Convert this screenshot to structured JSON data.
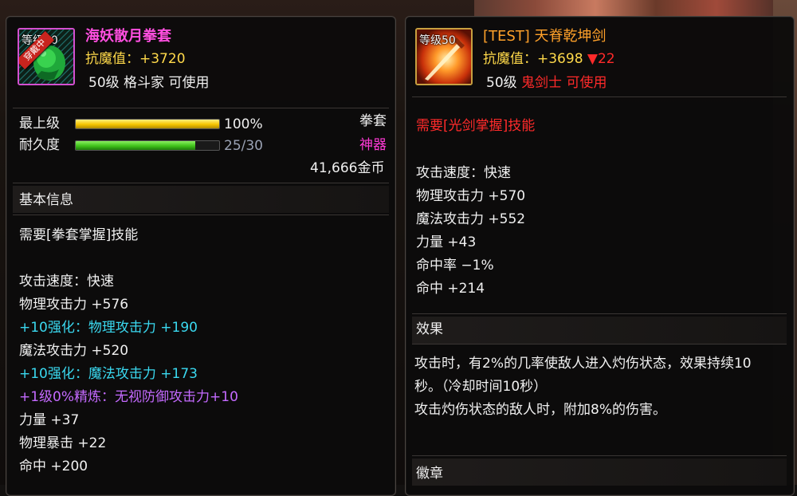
{
  "left": {
    "item_name": "海妖散月拳套",
    "icon_level": "等级50",
    "ribbon_text": "穿戴中",
    "resist_label": "抗魔值：",
    "resist_value": "+3720",
    "level_text": "50级",
    "job": "格斗家",
    "usable": "可使用",
    "grade_label": "最上级",
    "grade_percent": "100%",
    "grade_fill": 1.0,
    "durability_label": "耐久度",
    "durability_value": "25/30",
    "durability_fill": 0.8333,
    "item_type": "拳套",
    "rarity": "神器",
    "price": "41,666金币",
    "section_title": "基本信息",
    "requirement": "需要[拳套掌握]技能",
    "stats": [
      {
        "text": "攻击速度：快速",
        "color": "white"
      },
      {
        "text": "物理攻击力 +576",
        "color": "white"
      },
      {
        "text": "+10强化：物理攻击力 +190",
        "color": "cyan"
      },
      {
        "text": "魔法攻击力 +520",
        "color": "white"
      },
      {
        "text": "+10强化：魔法攻击力 +173",
        "color": "cyan"
      },
      {
        "text": "+1级0%精炼：无视防御攻击力+10",
        "color": "purple"
      },
      {
        "text": "力量 +37",
        "color": "white"
      },
      {
        "text": "物理暴击 +22",
        "color": "white"
      },
      {
        "text": "命中 +200",
        "color": "white"
      }
    ]
  },
  "right": {
    "item_name": "[TEST] 天脊乾坤剑",
    "icon_level": "等级50",
    "resist_label": "抗魔值：",
    "resist_value": "+3698",
    "resist_diff": "▼22",
    "level_text": "50级",
    "job": "鬼剑士",
    "usable": "可使用",
    "requirement": "需要[光剑掌握]技能",
    "stats": [
      "攻击速度：快速",
      "物理攻击力 +570",
      "魔法攻击力 +552",
      "力量 +43",
      "命中率 −1%",
      "命中 +214"
    ],
    "effect_title": "效果",
    "effect_lines": [
      "攻击时，有2%的几率使敌人进入灼伤状态，效果持续10",
      "秒。（冷却时间10秒）",
      "攻击灼伤状态的敌人时，附加8%的伤害。"
    ],
    "emblem_title": "徽章"
  },
  "colors": {
    "pink_name": "#ff4fe0",
    "orange_name": "#ffa12a",
    "resist_yellow": "#ffd94a",
    "enhance_cyan": "#3ad9f0",
    "refine_purple": "#c46aff",
    "warning_red": "#ff2a2a",
    "grade_bar": "#f5c400",
    "durability_bar": "#3fc21a",
    "artifact_magenta": "#ff3ad6"
  },
  "icons": {
    "left_item": "green-gauntlet-icon",
    "right_item": "flame-sword-icon"
  }
}
